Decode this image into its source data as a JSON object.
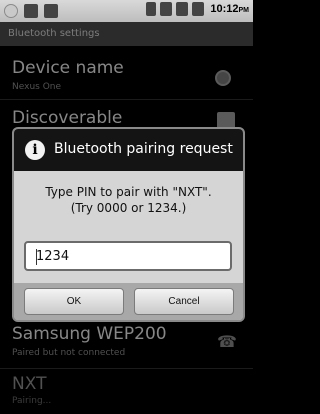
{
  "status_bar": {
    "time": "10:12",
    "time_suffix": "PM",
    "icons": [
      "notification-icon",
      "usb-icon",
      "sd-card-icon",
      "bluetooth-icon",
      "3g-signal-icon",
      "sms-icon",
      "alarm-icon"
    ]
  },
  "settings": {
    "title": "Bluetooth settings",
    "device_name": {
      "label": "Device name",
      "value": "Nexus One"
    },
    "discoverable": {
      "label": "Discoverable"
    }
  },
  "devices": [
    {
      "name": "Samsung WEP200",
      "status": "Paired but not connected"
    },
    {
      "name": "NXT",
      "status": "Pairing..."
    }
  ],
  "dialog": {
    "title": "Bluetooth pairing request",
    "message_line1": "Type PIN to pair with \"NXT\".",
    "message_line2": "(Try 0000 or 1234.)",
    "pin_value": "1234",
    "ok_label": "OK",
    "cancel_label": "Cancel"
  }
}
